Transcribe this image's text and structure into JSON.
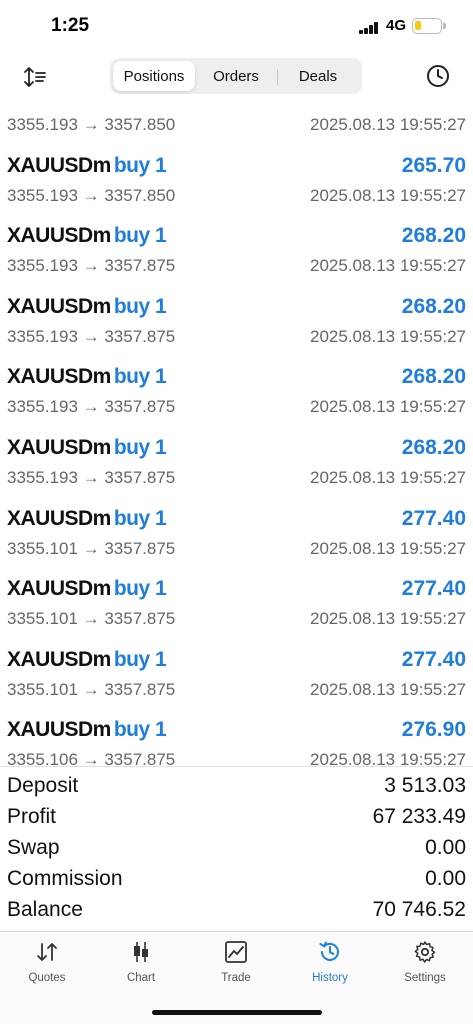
{
  "status_bar": {
    "time": "1:25",
    "network": "4G",
    "battery_level": 0.25
  },
  "toolbar": {
    "tabs": [
      {
        "label": "Positions",
        "active": true
      },
      {
        "label": "Orders",
        "active": false
      },
      {
        "label": "Deals",
        "active": false
      }
    ]
  },
  "deals": [
    {
      "symbol": "",
      "type": "",
      "profit": "",
      "prices": "3355.193 → 3357.850",
      "time": "2025.08.13 19:55:27"
    },
    {
      "symbol": "XAUUSDm",
      "type": "buy 1",
      "profit": "265.70",
      "prices": "3355.193 → 3357.850",
      "time": "2025.08.13 19:55:27"
    },
    {
      "symbol": "XAUUSDm",
      "type": "buy 1",
      "profit": "268.20",
      "prices": "3355.193 → 3357.875",
      "time": "2025.08.13 19:55:27"
    },
    {
      "symbol": "XAUUSDm",
      "type": "buy 1",
      "profit": "268.20",
      "prices": "3355.193 → 3357.875",
      "time": "2025.08.13 19:55:27"
    },
    {
      "symbol": "XAUUSDm",
      "type": "buy 1",
      "profit": "268.20",
      "prices": "3355.193 → 3357.875",
      "time": "2025.08.13 19:55:27"
    },
    {
      "symbol": "XAUUSDm",
      "type": "buy 1",
      "profit": "268.20",
      "prices": "3355.193 → 3357.875",
      "time": "2025.08.13 19:55:27"
    },
    {
      "symbol": "XAUUSDm",
      "type": "buy 1",
      "profit": "277.40",
      "prices": "3355.101 → 3357.875",
      "time": "2025.08.13 19:55:27"
    },
    {
      "symbol": "XAUUSDm",
      "type": "buy 1",
      "profit": "277.40",
      "prices": "3355.101 → 3357.875",
      "time": "2025.08.13 19:55:27"
    },
    {
      "symbol": "XAUUSDm",
      "type": "buy 1",
      "profit": "277.40",
      "prices": "3355.101 → 3357.875",
      "time": "2025.08.13 19:55:27"
    },
    {
      "symbol": "XAUUSDm",
      "type": "buy 1",
      "profit": "276.90",
      "prices": "3355.106 → 3357.875",
      "time": "2025.08.13 19:55:27"
    }
  ],
  "summary": [
    {
      "label": "Deposit",
      "value": "3 513.03"
    },
    {
      "label": "Profit",
      "value": "67 233.49"
    },
    {
      "label": "Swap",
      "value": "0.00"
    },
    {
      "label": "Commission",
      "value": "0.00"
    },
    {
      "label": "Balance",
      "value": "70 746.52"
    }
  ],
  "tabbar": {
    "items": [
      {
        "label": "Quotes",
        "icon": "quotes-arrows-icon",
        "active": false
      },
      {
        "label": "Chart",
        "icon": "candlestick-icon",
        "active": false
      },
      {
        "label": "Trade",
        "icon": "trade-chart-icon",
        "active": false
      },
      {
        "label": "History",
        "icon": "history-clock-icon",
        "active": true
      },
      {
        "label": "Settings",
        "icon": "gear-icon",
        "active": false
      }
    ]
  },
  "colors": {
    "accent": "#1f7ddc",
    "text": "#111111",
    "secondary_text": "#666666",
    "battery": "#f4cc17"
  }
}
